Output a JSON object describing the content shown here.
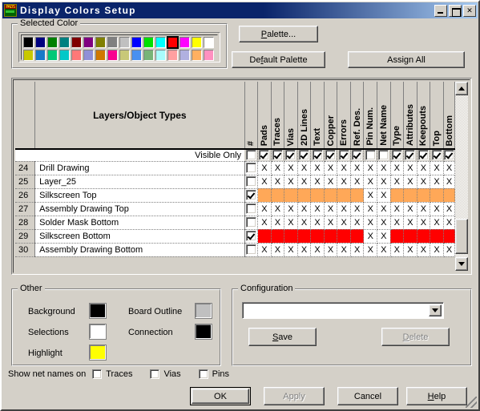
{
  "window": {
    "title": "Display Colors Setup",
    "icon": "pads-app-icon",
    "buttons": {
      "minimize": "_",
      "maximize": "□",
      "close": "✕"
    }
  },
  "selected_color": {
    "legend": "Selected Color",
    "row1": [
      "#000000",
      "#000080",
      "#008000",
      "#008080",
      "#800000",
      "#800080",
      "#808000",
      "#808080",
      "#c0c0c0",
      "#0000ff",
      "#00e000",
      "#00ffff",
      "#ff0000",
      "#ff00ff",
      "#ffff00",
      "#ffffff"
    ],
    "row2": [
      "#c8c800",
      "#1878c8",
      "#00c878",
      "#00c8c8",
      "#ff7878",
      "#9090d8",
      "#d07800",
      "#f80090",
      "#c8c878",
      "#4890f0",
      "#78b478",
      "#a8fcfc",
      "#ffa0a0",
      "#b0b0e0",
      "#ffb060",
      "#ff90c0"
    ],
    "selected_index": 12
  },
  "top_buttons": {
    "palette": "Palette...",
    "palette_accel": "P",
    "default_palette": "Default Palette",
    "default_palette_accel": "f",
    "assign_all": "Assign All"
  },
  "grid": {
    "main_header": "Layers/Object Types",
    "columns": [
      "#",
      "Pads",
      "Traces",
      "Vias",
      "2D Lines",
      "Text",
      "Copper",
      "Errors",
      "Ref. Des.",
      "Pin Num.",
      "Net Name",
      "Type",
      "Attributes",
      "Keepouts",
      "Top",
      "Bottom"
    ],
    "visible_only_label": "Visible Only",
    "visible_only_checks": [
      false,
      true,
      true,
      true,
      true,
      true,
      true,
      true,
      true,
      false,
      false,
      true,
      true,
      true,
      true,
      true
    ],
    "x_mark": "X",
    "rows": [
      {
        "num": "24",
        "name": "Drill Drawing",
        "checked": false,
        "color": null,
        "cells": [
          "x",
          "x",
          "x",
          "x",
          "x",
          "x",
          "x",
          "x",
          "x",
          "x",
          "x",
          "x",
          "x",
          "x",
          "x"
        ]
      },
      {
        "num": "25",
        "name": "Layer_25",
        "checked": false,
        "color": null,
        "cells": [
          "x",
          "x",
          "x",
          "x",
          "x",
          "x",
          "x",
          "x",
          "x",
          "x",
          "x",
          "x",
          "x",
          "x",
          "x"
        ]
      },
      {
        "num": "26",
        "name": "Silkscreen Top",
        "checked": true,
        "color": "#ffa858",
        "cells": [
          "c",
          "c",
          "c",
          "c",
          "c",
          "c",
          "c",
          "c",
          "x",
          "x",
          "c",
          "c",
          "c",
          "c",
          "c"
        ]
      },
      {
        "num": "27",
        "name": "Assembly Drawing Top",
        "checked": false,
        "color": null,
        "cells": [
          "x",
          "x",
          "x",
          "x",
          "x",
          "x",
          "x",
          "x",
          "x",
          "x",
          "x",
          "x",
          "x",
          "x",
          "x"
        ]
      },
      {
        "num": "28",
        "name": "Solder Mask Bottom",
        "checked": false,
        "color": null,
        "cells": [
          "x",
          "x",
          "x",
          "x",
          "x",
          "x",
          "x",
          "x",
          "x",
          "x",
          "x",
          "x",
          "x",
          "x",
          "x"
        ]
      },
      {
        "num": "29",
        "name": "Silkscreen Bottom",
        "checked": true,
        "color": "#ff0000",
        "cells": [
          "c",
          "c",
          "c",
          "c",
          "c",
          "c",
          "c",
          "c",
          "x",
          "x",
          "c",
          "c",
          "c",
          "c",
          "c"
        ]
      },
      {
        "num": "30",
        "name": "Assembly Drawing Bottom",
        "checked": false,
        "color": null,
        "cells": [
          "x",
          "x",
          "x",
          "x",
          "x",
          "x",
          "x",
          "x",
          "x",
          "x",
          "x",
          "x",
          "x",
          "x",
          "x"
        ]
      }
    ]
  },
  "other": {
    "legend": "Other",
    "background_label": "Background",
    "background_color": "#000000",
    "selections_label": "Selections",
    "selections_color": "#ffffff",
    "highlight_label": "Highlight",
    "highlight_color": "#ffff00",
    "board_outline_label": "Board Outline",
    "board_outline_color": "#c0c0c0",
    "connection_label": "Connection",
    "connection_color": "#000000"
  },
  "configuration": {
    "legend": "Configuration",
    "combo_value": "",
    "combo_arrow": "▼",
    "save_label": "Save",
    "save_accel": "S",
    "delete_label": "Delete",
    "delete_accel": "D",
    "delete_enabled": false
  },
  "net_names": {
    "label": "Show net names on",
    "options": [
      {
        "label": "Traces",
        "checked": false
      },
      {
        "label": "Vias",
        "checked": false
      },
      {
        "label": "Pins",
        "checked": false
      }
    ]
  },
  "dialog_buttons": {
    "ok": "OK",
    "apply": "Apply",
    "apply_enabled": false,
    "cancel": "Cancel",
    "help": "Help",
    "help_accel": "H"
  }
}
